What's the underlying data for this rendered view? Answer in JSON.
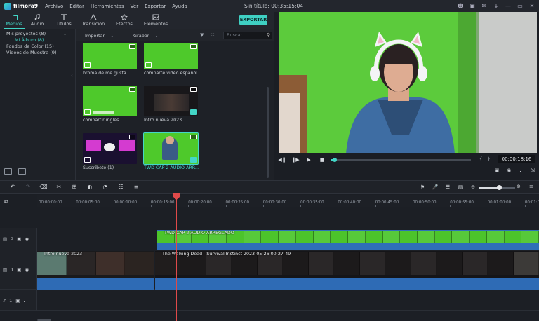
{
  "app": {
    "name": "filmora9",
    "doc_title": "Sin título:  00:35:15:04",
    "menu": [
      "Archivo",
      "Editar",
      "Herramientas",
      "Ver",
      "Exportar",
      "Ayuda"
    ]
  },
  "media_tabs": [
    {
      "label": "Medios",
      "icon": "folder-icon",
      "active": true
    },
    {
      "label": "Audio",
      "icon": "music-note-icon",
      "active": false
    },
    {
      "label": "Títulos",
      "icon": "text-icon",
      "active": false
    },
    {
      "label": "Transición",
      "icon": "transition-icon",
      "active": false
    },
    {
      "label": "Efectos",
      "icon": "effects-icon",
      "active": false
    },
    {
      "label": "Elementos",
      "icon": "elements-icon",
      "active": false
    }
  ],
  "export_label": "EXPORTAR",
  "sidebar": {
    "items": [
      "Mis proyectos (8)",
      "Mi Álbum (8)",
      "Fondos de Color (15)",
      "Vídeos de Muestra (9)"
    ]
  },
  "library": {
    "import_label": "Importar",
    "record_label": "Grabar",
    "search_placeholder": "Buscar",
    "clips": [
      {
        "label": "broma de me gusta",
        "kind": "green",
        "selected": false
      },
      {
        "label": "comparte video español",
        "kind": "green",
        "selected": false
      },
      {
        "label": "compartir inglés",
        "kind": "green",
        "selected": false
      },
      {
        "label": "Intro nueva 2023",
        "kind": "dark",
        "selected": false
      },
      {
        "label": "Suscribete (1)",
        "kind": "pink",
        "selected": false
      },
      {
        "label": "TWD CAP 2 AUDIO ARR...",
        "kind": "green",
        "selected": true
      }
    ]
  },
  "preview": {
    "timecode": "00:00:18:16",
    "progress": 0.03
  },
  "timeline": {
    "ruler_labels": [
      "00:00:00:00",
      "00:00:05:00",
      "00:00:10:00",
      "00:00:15:00",
      "00:00:20:00",
      "00:00:25:00",
      "00:00:30:00",
      "00:00:35:00",
      "00:00:40:00",
      "00:00:45:00",
      "00:00:50:00",
      "00:00:55:00",
      "00:01:00:00",
      "00:01:0"
    ],
    "zoom_level": 0.55,
    "tracks": [
      {
        "number": "2",
        "clip_title": "TWD CAP 2 AUDIO ARREGLADO"
      },
      {
        "number": "1",
        "intro_title": "Intro nueva 2023",
        "clip_title": "The Walking Dead - Survival Instinct 2023-05-26 00-27-49"
      },
      {
        "number": "1"
      }
    ]
  },
  "colors": {
    "accent": "#43d6c7",
    "green_screen": "#4ec92b",
    "playhead": "#e04a4a",
    "audio": "#2e6bb5"
  }
}
